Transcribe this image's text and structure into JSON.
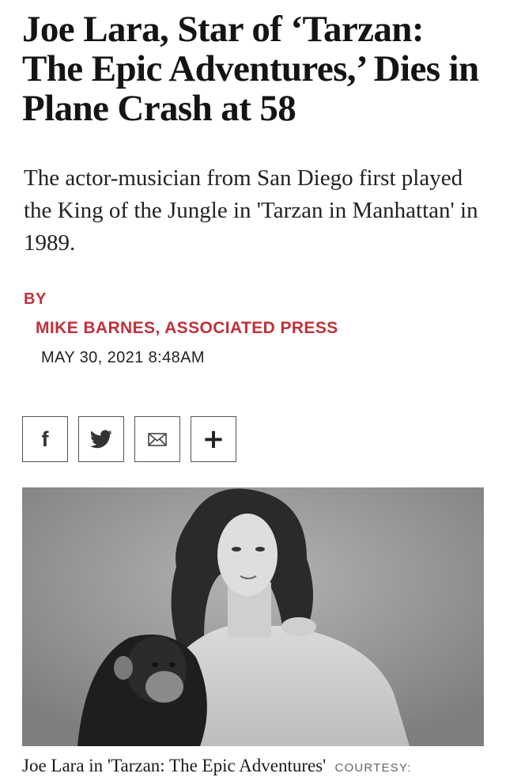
{
  "article": {
    "headline": "Joe Lara, Star of ‘Tarzan: The Epic Adventures,’ Dies in Plane Crash at 58",
    "dek": "The actor-musician from San Diego first played the King of the Jungle in 'Tarzan in Manhattan' in 1989.",
    "byline_label": "BY",
    "author": "MIKE BARNES, ASSOCIATED PRESS",
    "date": "MAY 30, 2021 8:48AM"
  },
  "share": {
    "buttons": [
      {
        "icon": "facebook-icon",
        "glyph": "f"
      },
      {
        "icon": "twitter-icon"
      },
      {
        "icon": "email-icon"
      },
      {
        "icon": "plus-icon",
        "glyph": "+"
      }
    ]
  },
  "image": {
    "caption": "Joe Lara in 'Tarzan: The Epic Adventures'",
    "credit": "COURTESY:"
  },
  "colors": {
    "accent": "#c0303a",
    "text": "#141414",
    "border": "#555555"
  }
}
